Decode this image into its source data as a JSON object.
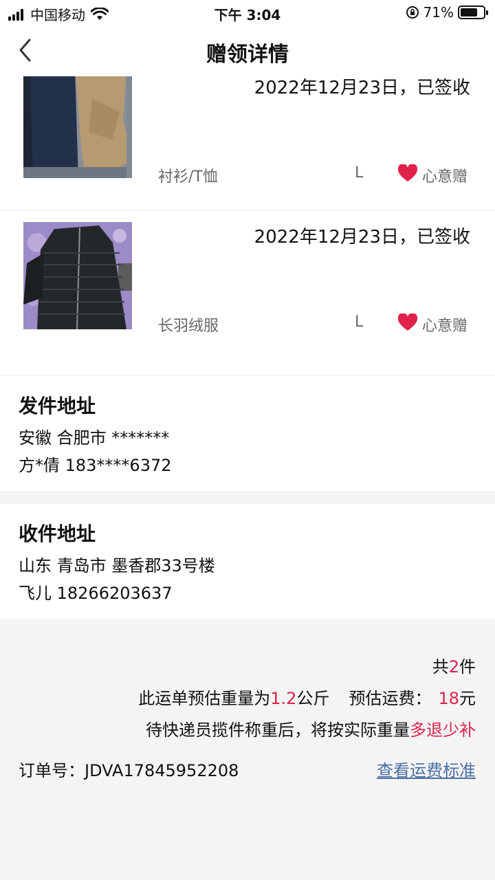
{
  "status_bar": {
    "carrier": "中国移动",
    "time": "下午 3:04",
    "battery": "71%"
  },
  "nav": {
    "title": "赠领详情"
  },
  "items": [
    {
      "status": "2022年12月23日，已签收",
      "category": "衬衫/T恤",
      "size": "L",
      "gift_type": "心意赠"
    },
    {
      "status": "2022年12月23日，已签收",
      "category": "长羽绒服",
      "size": "L",
      "gift_type": "心意赠"
    }
  ],
  "sender": {
    "title": "发件地址",
    "address": "安徽 合肥市 *******",
    "contact": "方*倩 183****6372"
  },
  "receiver": {
    "title": "收件地址",
    "address": "山东 青岛市 墨香郡33号楼",
    "contact": "飞儿 18266203637"
  },
  "summary": {
    "count_prefix": "共",
    "count": "2",
    "count_suffix": "件",
    "weight_prefix": "此运单预估重量为",
    "weight": "1.2",
    "weight_unit": "公斤",
    "fee_label": "预估运费：",
    "fee": "18",
    "fee_unit": "元",
    "note_prefix": "待快递员揽件称重后，将按实际重量",
    "note_highlight": "多退少补",
    "order_label": "订单号：",
    "order_number": "JDVA17845952208",
    "fee_link": "查看运费标准"
  },
  "colors": {
    "accent": "#e0224b",
    "link": "#4a6fa5"
  }
}
